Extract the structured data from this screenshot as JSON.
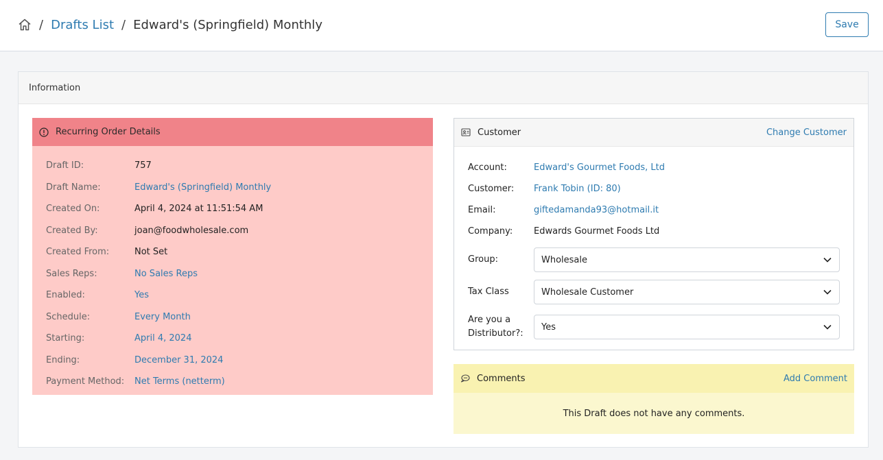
{
  "breadcrumb": {
    "home_icon": "home-icon",
    "separator": "/",
    "drafts_list": "Drafts List",
    "current": "Edward's (Springfield) Monthly"
  },
  "toolbar": {
    "save_label": "Save"
  },
  "panel": {
    "title": "Information"
  },
  "order": {
    "title": "Recurring Order Details",
    "icon": "info-icon",
    "rows": [
      {
        "label": "Draft ID:",
        "value": "757"
      },
      {
        "label": "Draft Name:",
        "value": "Edward's (Springfield) Monthly"
      },
      {
        "label": "Created On:",
        "value": "April 4, 2024 at 11:51:54 AM"
      },
      {
        "label": "Created By:",
        "value": "joan@foodwholesale.com"
      },
      {
        "label": "Created From:",
        "value": "Not Set"
      },
      {
        "label": "Sales Reps:",
        "value": "No Sales Reps"
      },
      {
        "label": "Enabled:",
        "value": "Yes"
      },
      {
        "label": "Schedule:",
        "value": "Every Month"
      },
      {
        "label": "Starting:",
        "value": "April 4, 2024"
      },
      {
        "label": "Ending:",
        "value": "December 31, 2024"
      },
      {
        "label": "Payment Method:",
        "value": "Net Terms (netterm)"
      }
    ]
  },
  "customer": {
    "title": "Customer",
    "icon": "contact-card-icon",
    "change_label": "Change Customer",
    "rows": [
      {
        "label": "Account:",
        "value": "Edward's Gourmet Foods, Ltd"
      },
      {
        "label": "Customer:",
        "value": "Frank Tobin (ID: 80)"
      },
      {
        "label": "Email:",
        "value": "giftedamanda93@hotmail.it"
      },
      {
        "label": "Company:",
        "value": "Edwards Gourmet Foods Ltd"
      }
    ],
    "selects": [
      {
        "label": "Group:",
        "value": "Wholesale"
      },
      {
        "label": "Tax Class",
        "value": "Wholesale Customer"
      },
      {
        "label": "Are you a Distributor?:",
        "value": "Yes"
      }
    ]
  },
  "comments": {
    "title": "Comments",
    "icon": "comment-icon",
    "add_label": "Add Comment",
    "empty_text": "This Draft does not have any comments."
  }
}
